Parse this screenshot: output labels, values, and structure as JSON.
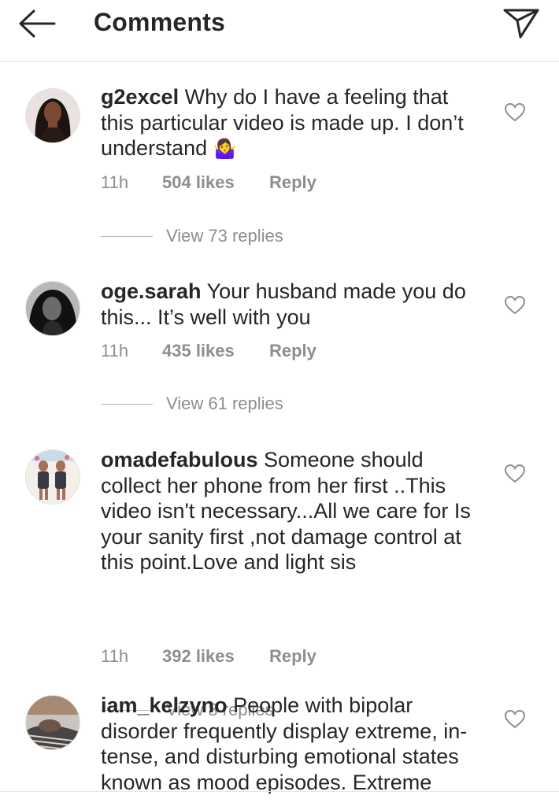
{
  "header": {
    "title": "Comments",
    "back_icon": "arrow-left-icon",
    "share_icon": "paper-plane-icon"
  },
  "colors": {
    "text": "#262626",
    "secondary": "#8e8e8e",
    "divider": "#dbdbdb"
  },
  "comments": [
    {
      "username": "g2excel",
      "text": "Why do I have a feeling that this particular video is made up. I don’t understand",
      "emoji": "🤷‍♀️",
      "time": "11h",
      "likes": "504 likes",
      "reply_label": "Reply",
      "view_replies": "View 73 replies"
    },
    {
      "username": "oge.sarah",
      "text": "Your husband made you do this... It’s well with you",
      "time": "11h",
      "likes": "435 likes",
      "reply_label": "Reply",
      "view_replies": "View 61 replies"
    },
    {
      "username": "omadefabulous",
      "text": "Someone should collect her phone from her first ..This video isn't necessary...All we care for Is your sanity first ,not damage control at this point.Love and light sis",
      "time": "11h",
      "likes": "392 likes",
      "reply_label": "Reply",
      "view_replies": "View 8 replies"
    },
    {
      "username": "iam_kelzyno",
      "text": "People with bipolar disorder frequently display extreme, in-tense, and disturbing emotional states known as mood episodes. Extreme"
    }
  ]
}
